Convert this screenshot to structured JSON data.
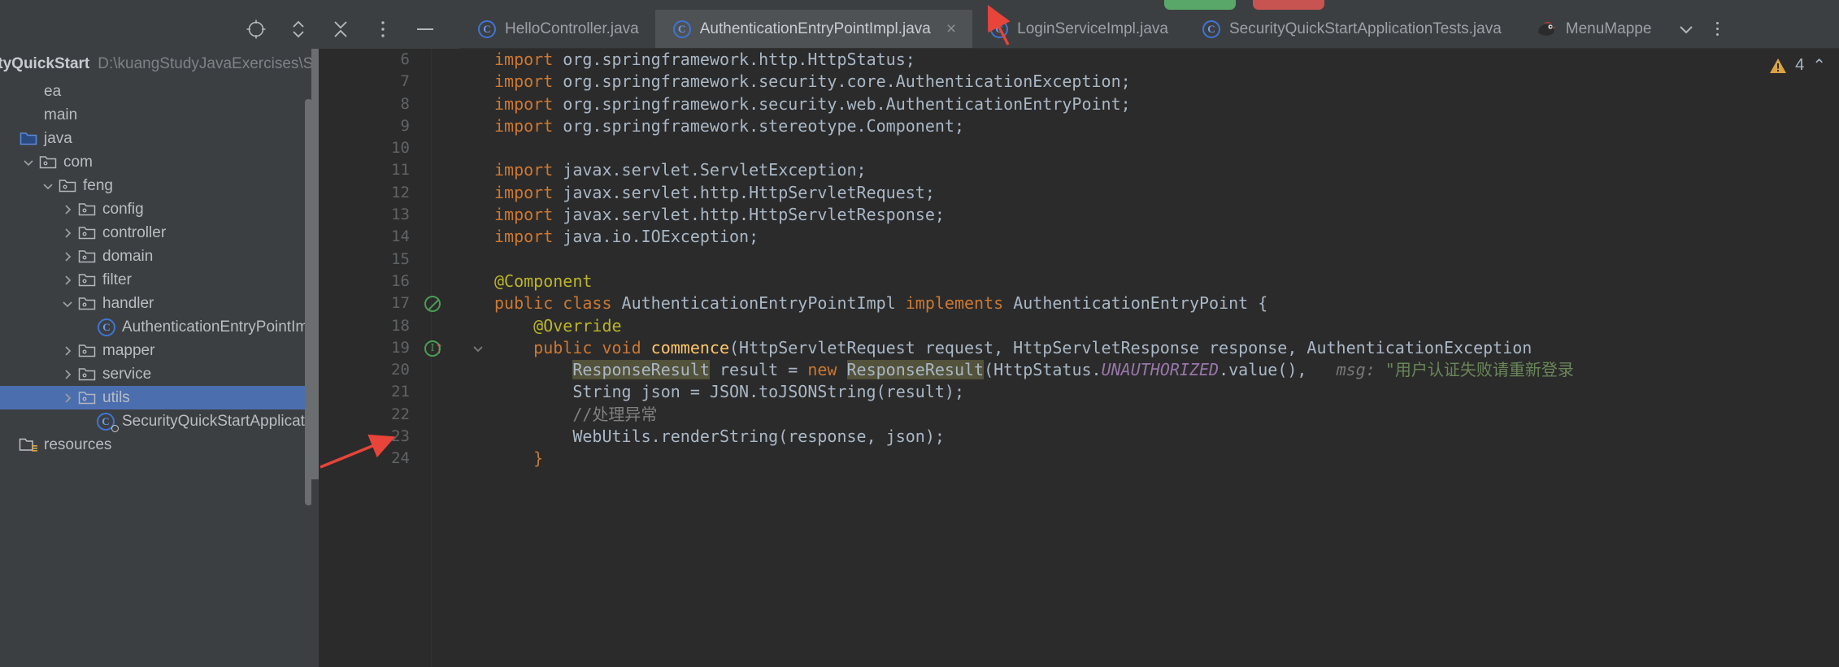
{
  "window": {
    "run_pill_green": "#59a869",
    "run_pill_red": "#c75450",
    "accent_selection": "#4b6eaf"
  },
  "toolbar": {
    "icons": [
      {
        "name": "locate-target-icon",
        "label": "Select Opened File"
      },
      {
        "name": "expand-collapse-icon",
        "label": "Expand All"
      },
      {
        "name": "collapse-all-icon",
        "label": "Collapse All"
      },
      {
        "name": "more-options-icon",
        "label": "Options"
      },
      {
        "name": "hide-panel-icon",
        "label": "Hide"
      }
    ]
  },
  "tabs": {
    "items": [
      {
        "label": "HelloController.java",
        "icon": "java-class-icon",
        "active": false,
        "closable": false
      },
      {
        "label": "AuthenticationEntryPointImpl.java",
        "icon": "java-class-icon",
        "active": true,
        "closable": true
      },
      {
        "label": "LoginServiceImpl.java",
        "icon": "java-class-icon",
        "active": false,
        "closable": false
      },
      {
        "label": "SecurityQuickStartApplicationTests.java",
        "icon": "java-class-icon",
        "active": false,
        "closable": false
      },
      {
        "label": "MenuMappe",
        "icon": "mybatis-icon",
        "active": false,
        "closable": false
      }
    ],
    "overflow_label": "⌄",
    "close_glyph": "×"
  },
  "project": {
    "name": "ityQuickStart",
    "path": "D:\\kuangStudyJavaExercises\\SecurityQ",
    "tree": [
      {
        "label": "ea",
        "indent": 0,
        "twist": "",
        "icon": "none"
      },
      {
        "label": "main",
        "indent": 0,
        "twist": "",
        "icon": "none"
      },
      {
        "label": "java",
        "indent": 0,
        "twist": "",
        "icon": "source-folder-icon"
      },
      {
        "label": "com",
        "indent": 1,
        "twist": "down",
        "icon": "package-icon"
      },
      {
        "label": "feng",
        "indent": 2,
        "twist": "down",
        "icon": "package-icon"
      },
      {
        "label": "config",
        "indent": 3,
        "twist": "right",
        "icon": "package-icon"
      },
      {
        "label": "controller",
        "indent": 3,
        "twist": "right",
        "icon": "package-icon"
      },
      {
        "label": "domain",
        "indent": 3,
        "twist": "right",
        "icon": "package-icon"
      },
      {
        "label": "filter",
        "indent": 3,
        "twist": "right",
        "icon": "package-icon"
      },
      {
        "label": "handler",
        "indent": 3,
        "twist": "down",
        "icon": "package-icon"
      },
      {
        "label": "AuthenticationEntryPointImpl",
        "indent": 4,
        "twist": "",
        "icon": "java-class-icon"
      },
      {
        "label": "mapper",
        "indent": 3,
        "twist": "right",
        "icon": "package-icon"
      },
      {
        "label": "service",
        "indent": 3,
        "twist": "right",
        "icon": "package-icon"
      },
      {
        "label": "utils",
        "indent": 3,
        "twist": "right",
        "icon": "package-icon",
        "selected": true
      },
      {
        "label": "SecurityQuickStartApplication",
        "indent": 4,
        "twist": "",
        "icon": "java-class-runnable-icon"
      },
      {
        "label": "resources",
        "indent": 0,
        "twist": "",
        "icon": "resources-folder-icon"
      }
    ]
  },
  "inspection": {
    "count": "4",
    "collapse_glyph": "⌃",
    "warning_icon": "warning-triangle-icon"
  },
  "editor": {
    "first_line": 6,
    "lines": [
      {
        "n": 6,
        "gutter": "",
        "fold": "",
        "tokens": [
          {
            "t": "import ",
            "c": "kw"
          },
          {
            "t": "org.springframework.http.",
            "c": "id"
          },
          {
            "t": "HttpStatus",
            "c": "id"
          },
          {
            "t": ";",
            "c": "id"
          }
        ]
      },
      {
        "n": 7,
        "gutter": "",
        "fold": "",
        "tokens": [
          {
            "t": "import ",
            "c": "kw"
          },
          {
            "t": "org.springframework.security.core.AuthenticationException;",
            "c": "id"
          }
        ]
      },
      {
        "n": 8,
        "gutter": "",
        "fold": "",
        "tokens": [
          {
            "t": "import ",
            "c": "kw"
          },
          {
            "t": "org.springframework.security.web.AuthenticationEntryPoint;",
            "c": "id"
          }
        ]
      },
      {
        "n": 9,
        "gutter": "",
        "fold": "",
        "tokens": [
          {
            "t": "import ",
            "c": "kw"
          },
          {
            "t": "org.springframework.stereotype.",
            "c": "id"
          },
          {
            "t": "Component",
            "c": "id"
          },
          {
            "t": ";",
            "c": "id"
          }
        ]
      },
      {
        "n": 10,
        "gutter": "",
        "fold": "",
        "tokens": []
      },
      {
        "n": 11,
        "gutter": "",
        "fold": "",
        "tokens": [
          {
            "t": "import ",
            "c": "kw"
          },
          {
            "t": "javax.servlet.ServletException;",
            "c": "id"
          }
        ]
      },
      {
        "n": 12,
        "gutter": "",
        "fold": "",
        "tokens": [
          {
            "t": "import ",
            "c": "kw"
          },
          {
            "t": "javax.servlet.http.HttpServletRequest;",
            "c": "id"
          }
        ]
      },
      {
        "n": 13,
        "gutter": "",
        "fold": "",
        "tokens": [
          {
            "t": "import ",
            "c": "kw"
          },
          {
            "t": "javax.servlet.http.HttpServletResponse;",
            "c": "id"
          }
        ]
      },
      {
        "n": 14,
        "gutter": "",
        "fold": "",
        "tokens": [
          {
            "t": "import ",
            "c": "kw"
          },
          {
            "t": "java.io.IOException;",
            "c": "id"
          }
        ]
      },
      {
        "n": 15,
        "gutter": "",
        "fold": "",
        "tokens": []
      },
      {
        "n": 16,
        "gutter": "",
        "fold": "",
        "tokens": [
          {
            "t": "@Component",
            "c": "ann"
          }
        ]
      },
      {
        "n": 17,
        "gutter": "green-circle",
        "fold": "",
        "tokens": [
          {
            "t": "public class ",
            "c": "kw"
          },
          {
            "t": "AuthenticationEntryPointImpl ",
            "c": "id"
          },
          {
            "t": "implements ",
            "c": "kw"
          },
          {
            "t": "AuthenticationEntryPoint {",
            "c": "id"
          }
        ]
      },
      {
        "n": 18,
        "gutter": "",
        "fold": "",
        "tokens": [
          {
            "t": "    @Override",
            "c": "ann"
          }
        ]
      },
      {
        "n": 19,
        "gutter": "impl-arrow",
        "fold": "down",
        "tokens": [
          {
            "t": "    public void ",
            "c": "kw"
          },
          {
            "t": "commence",
            "c": "meth"
          },
          {
            "t": "(HttpServletRequest request, HttpServletResponse response, AuthenticationException ",
            "c": "id"
          }
        ]
      },
      {
        "n": 20,
        "gutter": "",
        "fold": "",
        "tokens": [
          {
            "t": "        ",
            "c": "id"
          },
          {
            "t": "ResponseResult",
            "c": "hl"
          },
          {
            "t": " result = ",
            "c": "id"
          },
          {
            "t": "new ",
            "c": "kw"
          },
          {
            "t": "ResponseResult",
            "c": "hl"
          },
          {
            "t": "(HttpStatus.",
            "c": "id"
          },
          {
            "t": "UNAUTHORIZED",
            "c": "stat"
          },
          {
            "t": ".value(), ",
            "c": "id"
          },
          {
            "t": "  msg:",
            "c": "hint"
          },
          {
            "t": " \"用户认证失败请重新登录",
            "c": "str"
          }
        ]
      },
      {
        "n": 21,
        "gutter": "",
        "fold": "",
        "tokens": [
          {
            "t": "        String json = JSON.",
            "c": "id"
          },
          {
            "t": "toJSONString",
            "c": "id"
          },
          {
            "t": "(result);",
            "c": "id"
          }
        ]
      },
      {
        "n": 22,
        "gutter": "",
        "fold": "",
        "tokens": [
          {
            "t": "        //处理异常",
            "c": "cmt"
          }
        ]
      },
      {
        "n": 23,
        "gutter": "",
        "fold": "",
        "tokens": [
          {
            "t": "        WebUtils.",
            "c": "id"
          },
          {
            "t": "renderString",
            "c": "id"
          },
          {
            "t": "(response, json);",
            "c": "id"
          }
        ]
      },
      {
        "n": 24,
        "gutter": "",
        "fold": "",
        "tokens": [
          {
            "t": "    }",
            "c": "kw"
          }
        ]
      }
    ]
  }
}
